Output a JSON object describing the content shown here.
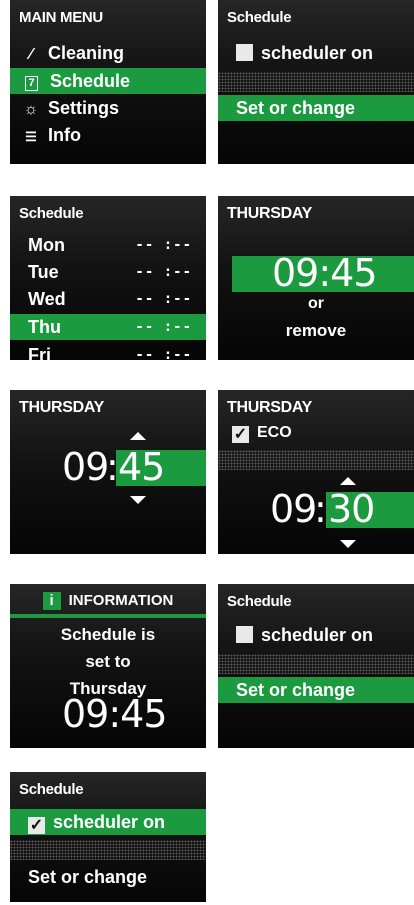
{
  "main_menu": {
    "title": "MAIN MENU",
    "items": [
      {
        "label": "Cleaning",
        "icon": "broom-icon",
        "glyph": "⁄"
      },
      {
        "label": "Schedule",
        "icon": "calendar-icon",
        "glyph": "7"
      },
      {
        "label": "Settings",
        "icon": "gear-icon",
        "glyph": "☼"
      },
      {
        "label": "Info",
        "icon": "info-icon",
        "glyph": "☰"
      }
    ]
  },
  "schedule_1": {
    "title": "Schedule",
    "checkbox_label": "scheduler on",
    "checked": false,
    "action": "Set or change"
  },
  "day_list": {
    "title": "Schedule",
    "days": [
      {
        "day": "Mon",
        "time": "-- :--"
      },
      {
        "day": "Tue",
        "time": "-- :--"
      },
      {
        "day": "Wed",
        "time": "-- :--"
      },
      {
        "day": "Thu",
        "time": "-- :--"
      },
      {
        "day": "Fri",
        "time": "-- :--"
      }
    ]
  },
  "thursday_1": {
    "title": "THURSDAY",
    "time": "09:45",
    "or": "or",
    "remove": "remove"
  },
  "thursday_2": {
    "title": "THURSDAY",
    "hours": "09",
    "minutes": "45"
  },
  "thursday_3": {
    "title": "THURSDAY",
    "eco_label": "ECO",
    "eco_checked": true,
    "hours": "09",
    "minutes": "30"
  },
  "information": {
    "title": "INFORMATION",
    "line1": "Schedule is",
    "line2": "set to",
    "line3": "Thursday",
    "time": "09:45"
  },
  "schedule_2": {
    "title": "Schedule",
    "checkbox_label": "scheduler on",
    "checked": false,
    "action": "Set or change"
  },
  "schedule_3": {
    "title": "Schedule",
    "checkbox_label": "scheduler on",
    "checked": true,
    "checkmark": "✓",
    "action": "Set or change"
  },
  "colors": {
    "accent": "#1c9a40",
    "screen_bg": "#111111",
    "text": "#ffffff"
  }
}
